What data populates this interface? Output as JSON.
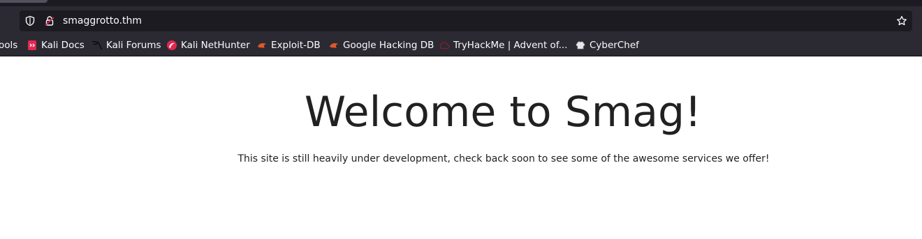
{
  "browser": {
    "url": "smaggrotto.thm",
    "bookmarks": [
      {
        "label": "ools",
        "icon": "tools-icon"
      },
      {
        "label": "Kali Docs",
        "icon": "kali-docs-icon"
      },
      {
        "label": "Kali Forums",
        "icon": "kali-dragon-icon"
      },
      {
        "label": "Kali NetHunter",
        "icon": "nethunter-icon"
      },
      {
        "label": "Exploit-DB",
        "icon": "exploit-db-icon"
      },
      {
        "label": "Google Hacking DB",
        "icon": "ghdb-icon"
      },
      {
        "label": "TryHackMe | Advent of...",
        "icon": "tryhackme-icon"
      },
      {
        "label": "CyberChef",
        "icon": "cyberchef-icon"
      }
    ]
  },
  "page": {
    "heading": "Welcome to Smag!",
    "subtitle": "This site is still heavily under development, check back soon to see some of the awesome services we offer!"
  },
  "colors": {
    "chrome_bg": "#2b2a33",
    "urlbar_bg": "#1c1b22",
    "chrome_text": "#fbfbfe",
    "page_text": "#212121",
    "accent_red": "#e22850",
    "exploit_orange": "#e0572a"
  }
}
